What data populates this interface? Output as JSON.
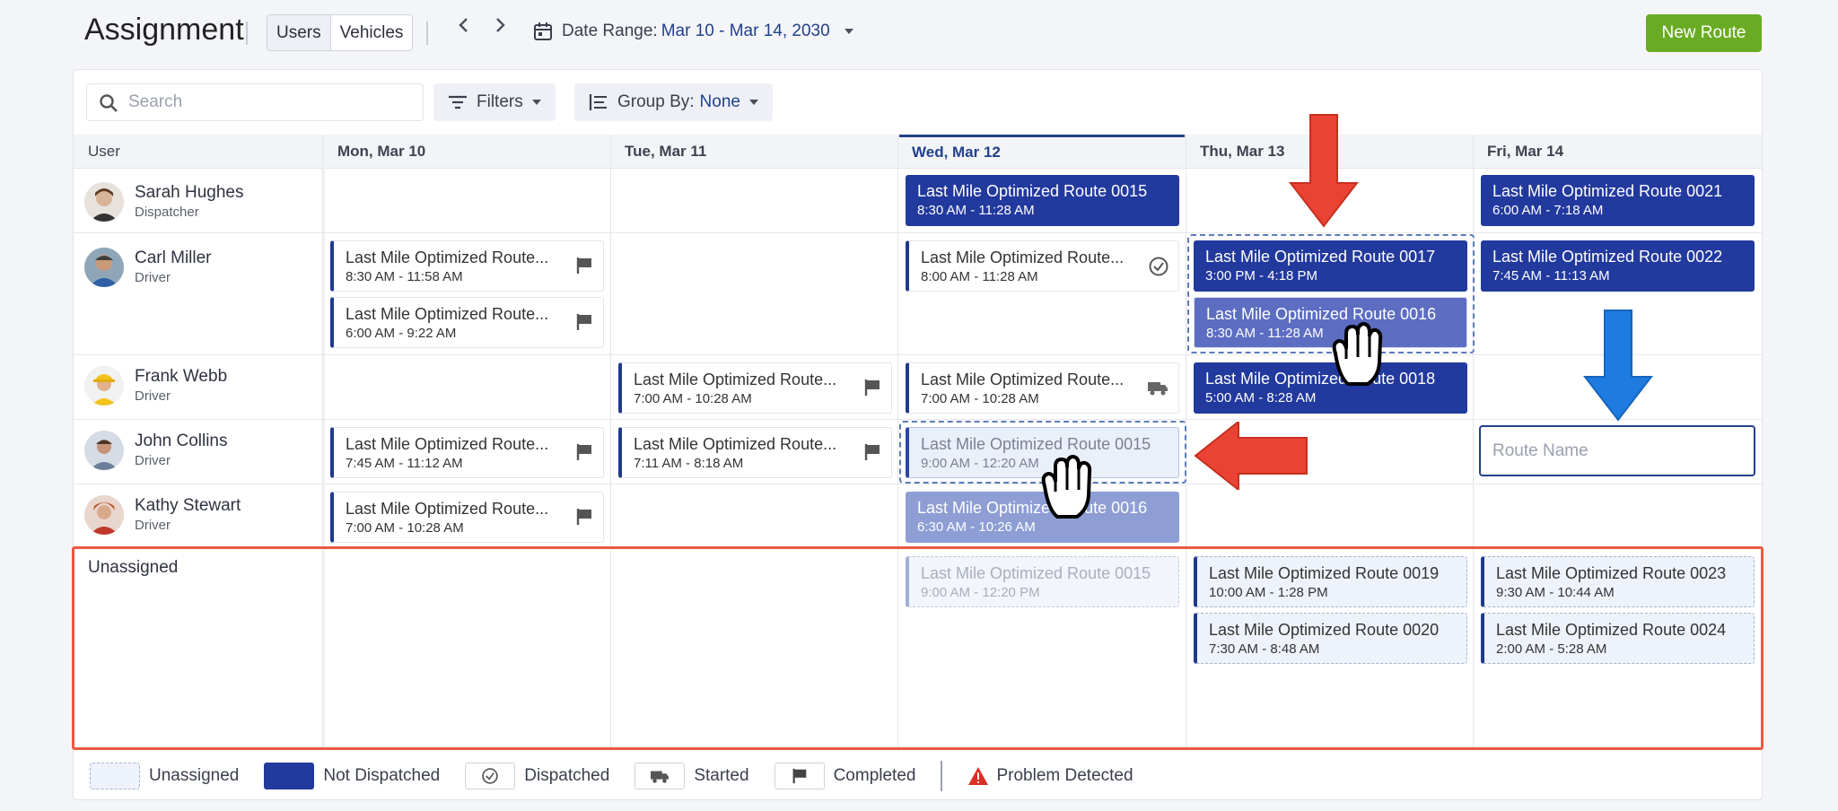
{
  "header": {
    "title": "Assignment",
    "view_tabs": [
      "Users",
      "Vehicles"
    ],
    "date_range_label": "Date Range:",
    "date_range_value": "Mar 10 - Mar 14, 2030",
    "new_route_label": "New Route"
  },
  "toolbar": {
    "search_placeholder": "Search",
    "filters_label": "Filters",
    "group_by_label": "Group By:",
    "group_by_value": "None"
  },
  "columns": {
    "user": "User",
    "days": [
      "Mon, Mar 10",
      "Tue, Mar 11",
      "Wed, Mar 12",
      "Thu, Mar 13",
      "Fri, Mar 14"
    ]
  },
  "users": [
    {
      "name": "Sarah Hughes",
      "role": "Dispatcher"
    },
    {
      "name": "Carl Miller",
      "role": "Driver"
    },
    {
      "name": "Frank Webb",
      "role": "Driver"
    },
    {
      "name": "John Collins",
      "role": "Driver"
    },
    {
      "name": "Kathy Stewart",
      "role": "Driver"
    }
  ],
  "unassigned_label": "Unassigned",
  "cards": [
    {
      "name": "Last Mile Optimized Route 0015",
      "time": "8:30 AM - 11:28 AM"
    },
    {
      "name": "Last Mile Optimized Route 0021",
      "time": "6:00 AM - 7:18 AM"
    },
    {
      "name": "Last Mile Optimized Route...",
      "time": "8:30 AM - 11:58 AM"
    },
    {
      "name": "Last Mile Optimized Route...",
      "time": "6:00 AM - 9:22 AM"
    },
    {
      "name": "Last Mile Optimized Route...",
      "time": "8:00 AM - 11:28 AM"
    },
    {
      "name": "Last Mile Optimized Route 0017",
      "time": "3:00 PM - 4:18 PM"
    },
    {
      "name": "Last Mile Optimized Route 0016",
      "time": "8:30 AM - 11:28 AM"
    },
    {
      "name": "Last Mile Optimized Route 0022",
      "time": "7:45 AM - 11:13 AM"
    },
    {
      "name": "Last Mile Optimized Route...",
      "time": "7:00 AM - 10:28 AM"
    },
    {
      "name": "Last Mile Optimized Route...",
      "time": "7:00 AM - 10:28 AM"
    },
    {
      "name": "Last Mile Optimized Route 0018",
      "time": "5:00 AM - 8:28 AM"
    },
    {
      "name": "Last Mile Optimized Route...",
      "time": "7:45 AM - 11:12 AM"
    },
    {
      "name": "Last Mile Optimized Route...",
      "time": "7:11 AM - 8:18 AM"
    },
    {
      "name": "Last Mile Optimized Route 0015",
      "time": "9:00 AM - 12:20 AM"
    },
    {
      "name": "Last Mile Optimized Route...",
      "time": "7:00 AM - 10:28 AM"
    },
    {
      "name": "Last Mile Optimized Route 0016",
      "time": "6:30 AM - 10:26 AM"
    },
    {
      "name": "Last Mile Optimized Route 0015",
      "time": "9:00 AM - 12:20 PM"
    },
    {
      "name": "Last Mile Optimized Route 0019",
      "time": "10:00 AM - 1:28 PM"
    },
    {
      "name": "Last Mile Optimized Route 0020",
      "time": "7:30 AM - 8:48 AM"
    },
    {
      "name": "Last Mile Optimized Route 0023",
      "time": "9:30 AM - 10:44 AM"
    },
    {
      "name": "Last Mile Optimized Route 0024",
      "time": "2:00 AM - 5:28 AM"
    }
  ],
  "route_name_placeholder": "Route Name",
  "legend": [
    "Unassigned",
    "Not Dispatched",
    "Dispatched",
    "Started",
    "Completed",
    "Problem Detected"
  ],
  "colors": {
    "accent": "#22408c",
    "not_dispatched": "#22399e",
    "new_route": "#6aab24",
    "highlight": "#e85a41",
    "arrow_red": "#ea4335",
    "arrow_blue": "#1e7be0"
  }
}
